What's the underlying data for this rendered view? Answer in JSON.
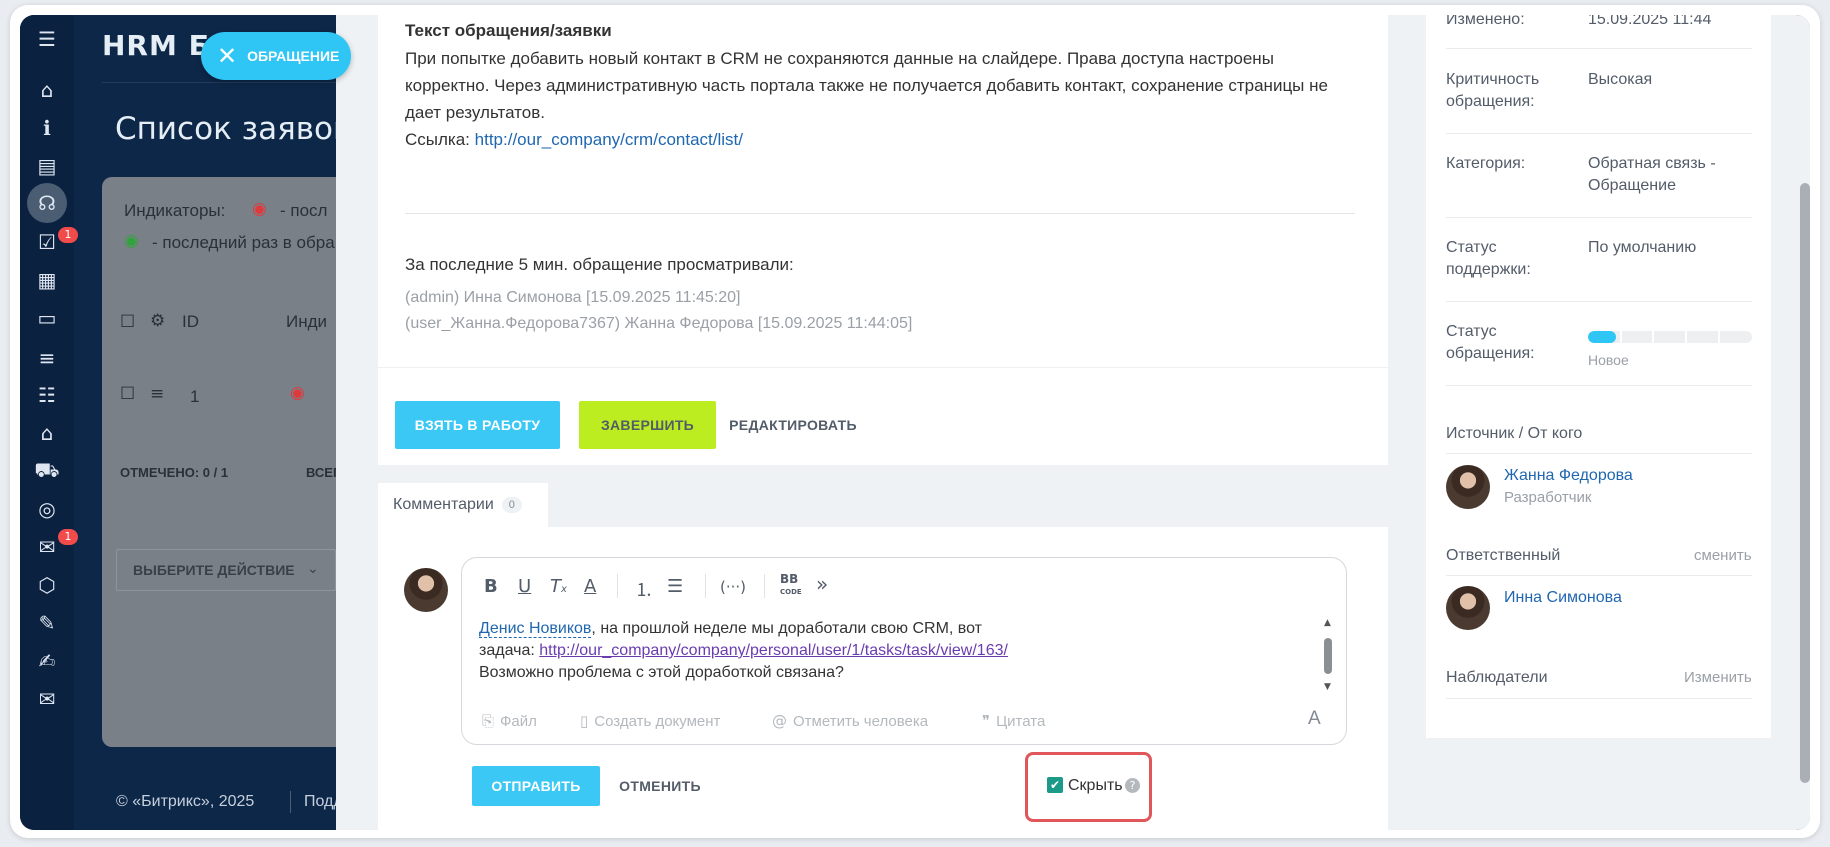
{
  "portal": {
    "brand": "HRM Б",
    "page_title": "Список заявок (",
    "indicators_label": "Индикаторы:",
    "indicator_1_text": "- посл",
    "indicator_2_text": "- последний раз в обра",
    "col_id": "ID",
    "col_ind": "Инди",
    "row_id": "1",
    "marked": "ОТМЕЧЕНО: 0 / 1",
    "total": "ВСЕГ",
    "action_select": "ВЫБЕРИТЕ ДЕЙСТВИЕ",
    "footer_copy": "© «Битрикс», 2025",
    "footer_more": "Подд",
    "close_pill_label": "ОБРАЩЕНИЕ"
  },
  "nav": {
    "icons": [
      "menu-icon",
      "home-icon",
      "info-icon",
      "inbox-icon",
      "support-icon",
      "tasks-icon",
      "calendar-icon",
      "drive-icon",
      "filter-icon",
      "checklist-icon",
      "company-icon",
      "cart-icon",
      "target-icon",
      "chat-icon",
      "settings-icon",
      "doc-edit-icon",
      "sign-icon",
      "mail-icon"
    ],
    "tasks_badge": "1",
    "chat_badge": "1"
  },
  "ticket": {
    "section_title": "Текст обращения/заявки",
    "description_lines": [
      "При попытке добавить новый контакт в CRM не сохраняются данные на слайдере. Права доступа настроены",
      "корректно. Через административную часть портала также не получается добавить контакт, сохранение страницы не",
      "дает результатов."
    ],
    "link_prefix": "Ссылка:",
    "link_url": "http://our_company/crm/contact/list/",
    "viewed_title": "За последние 5 мин. обращение просматривали:",
    "viewers": [
      "(admin) Инна Симонова [15.09.2025 11:45:20]",
      "(user_Жанна.Федорова7367) Жанна Федорова [15.09.2025 11:44:05]"
    ]
  },
  "actions": {
    "take": "ВЗЯТЬ В РАБОТУ",
    "finish": "ЗАВЕРШИТЬ",
    "edit": "РЕДАКТИРОВАТЬ"
  },
  "comments": {
    "tab_label": "Комментарии",
    "count": "0",
    "mention": "Денис Новиков",
    "line1_rest": ", на прошлой неделе мы доработали свою CRM, вот",
    "line2_prefix": "задача:",
    "line2_link": "http://our_company/company/personal/user/1/tasks/task/view/163/",
    "line3": "Возможно проблема с этой доработкой связана?",
    "footer": {
      "file": "Файл",
      "create_doc": "Создать документ",
      "mention": "Отметить человека",
      "quote": "Цитата"
    },
    "send": "ОТПРАВИТЬ",
    "cancel": "ОТМЕНИТЬ",
    "hide_label": "Скрыть",
    "hide_checked": true
  },
  "info": {
    "changed_label": "Изменено:",
    "changed_value": "15.09.2025 11:44",
    "criticality_label_1": "Критичность",
    "criticality_label_2": "обращения:",
    "criticality_value": "Высокая",
    "category_label": "Категория:",
    "category_value_1": "Обратная связь -",
    "category_value_2": "Обращение",
    "support_status_label_1": "Статус",
    "support_status_label_2": "поддержки:",
    "support_status_value": "По умолчанию",
    "ticket_status_label_1": "Статус",
    "ticket_status_label_2": "обращения:",
    "ticket_status_value": "Новое",
    "ticket_status_progress": 0.17,
    "source_label": "Источник / От кого",
    "source_name": "Жанна Федорова",
    "source_role": "Разработчик",
    "responsible_label": "Ответственный",
    "responsible_change": "сменить",
    "responsible_name": "Инна Симонова",
    "observers_label": "Наблюдатели",
    "observers_change": "Изменить"
  },
  "colors": {
    "accent_blue": "#3bc8f5",
    "accent_green": "#bbed21",
    "highlight_red": "#e0565a"
  }
}
